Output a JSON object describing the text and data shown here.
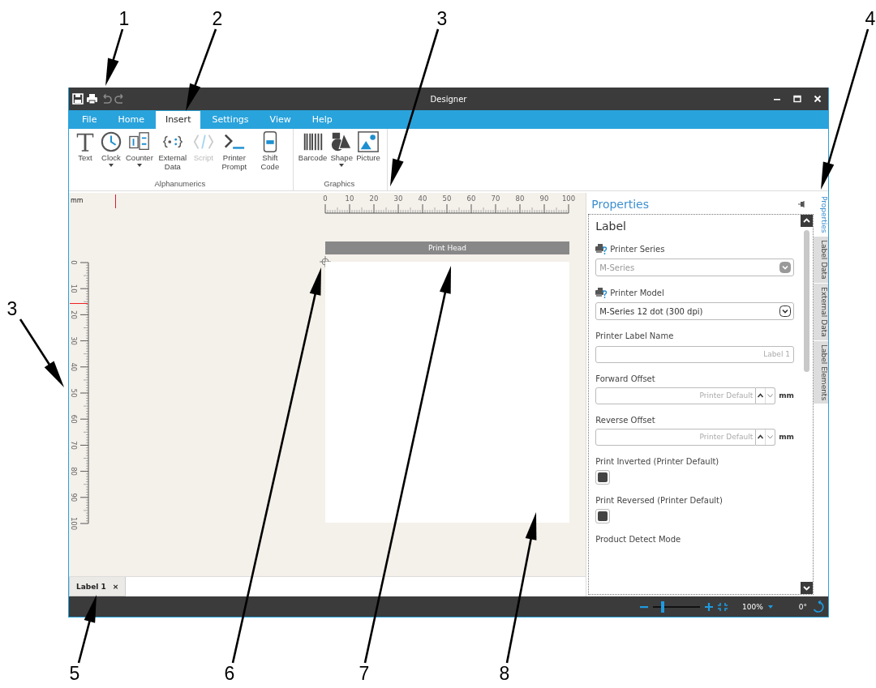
{
  "callouts": [
    {
      "label": "1"
    },
    {
      "label": "2"
    },
    {
      "label": "3"
    },
    {
      "label": "4"
    },
    {
      "label": "3"
    },
    {
      "label": "5"
    },
    {
      "label": "6"
    },
    {
      "label": "7"
    },
    {
      "label": "8"
    }
  ],
  "window": {
    "title": "Designer"
  },
  "menu_tabs": [
    {
      "label": "File",
      "selected": false
    },
    {
      "label": "Home",
      "selected": false
    },
    {
      "label": "Insert",
      "selected": true
    },
    {
      "label": "Settings",
      "selected": false
    },
    {
      "label": "View",
      "selected": false
    },
    {
      "label": "Help",
      "selected": false
    }
  ],
  "ribbon": {
    "groups": [
      {
        "name": "Alphanumerics",
        "tools": [
          {
            "kind": "text",
            "label": "Text",
            "dropdown": false,
            "disabled": false
          },
          {
            "kind": "clock",
            "label": "Clock",
            "dropdown": true,
            "disabled": false
          },
          {
            "kind": "counter",
            "label": "Counter",
            "dropdown": true,
            "disabled": false
          },
          {
            "kind": "external",
            "label": "External Data",
            "dropdown": false,
            "disabled": false
          },
          {
            "kind": "script",
            "label": "Script",
            "dropdown": false,
            "disabled": true
          },
          {
            "kind": "prompt",
            "label": "Printer Prompt",
            "dropdown": false,
            "disabled": false
          },
          {
            "kind": "shift",
            "label": "Shift Code",
            "dropdown": false,
            "disabled": false
          }
        ]
      },
      {
        "name": "Graphics",
        "tools": [
          {
            "kind": "barcode",
            "label": "Barcode",
            "dropdown": false,
            "disabled": false
          },
          {
            "kind": "shape",
            "label": "Shape",
            "dropdown": true,
            "disabled": false
          },
          {
            "kind": "picture",
            "label": "Picture",
            "dropdown": false,
            "disabled": false
          }
        ]
      }
    ]
  },
  "canvas": {
    "unit": "mm",
    "h_ruler": [
      "0",
      "10",
      "20",
      "30",
      "40",
      "50",
      "60",
      "70",
      "80",
      "90",
      "100"
    ],
    "v_ruler": [
      "0",
      "10",
      "20",
      "30",
      "40",
      "50",
      "60",
      "70",
      "80",
      "90",
      "100"
    ],
    "print_head": "Print Head"
  },
  "document_tabs": [
    {
      "label": "Label 1",
      "close": "×",
      "selected": true
    }
  ],
  "properties": {
    "title": "Properties",
    "section": "Label",
    "fields": [
      {
        "kind": "select",
        "label": "Printer Series",
        "value": "M-Series",
        "disabled": true,
        "printer_icon": true
      },
      {
        "kind": "select",
        "label": "Printer Model",
        "value": "M-Series 12 dot (300 dpi)",
        "disabled": false,
        "printer_icon": true
      },
      {
        "kind": "text",
        "label": "Printer Label Name",
        "placeholder": "Label 1"
      },
      {
        "kind": "spinner",
        "label": "Forward Offset",
        "placeholder": "Printer Default",
        "unit": "mm"
      },
      {
        "kind": "spinner",
        "label": "Reverse Offset",
        "placeholder": "Printer Default",
        "unit": "mm"
      },
      {
        "kind": "checkbox",
        "label": "Print Inverted (Printer Default)",
        "checked": true
      },
      {
        "kind": "checkbox",
        "label": "Print Reversed (Printer Default)",
        "checked": true
      },
      {
        "kind": "label",
        "label": "Product Detect Mode"
      }
    ]
  },
  "side_tabs": [
    {
      "label": "Properties",
      "selected": true
    },
    {
      "label": "Label Data",
      "selected": false
    },
    {
      "label": "External Data",
      "selected": false
    },
    {
      "label": "Label Elements",
      "selected": false
    }
  ],
  "status_bar": {
    "zoom": {
      "level": 0.2
    },
    "zoom_value": "100%",
    "rotation": "0°"
  }
}
